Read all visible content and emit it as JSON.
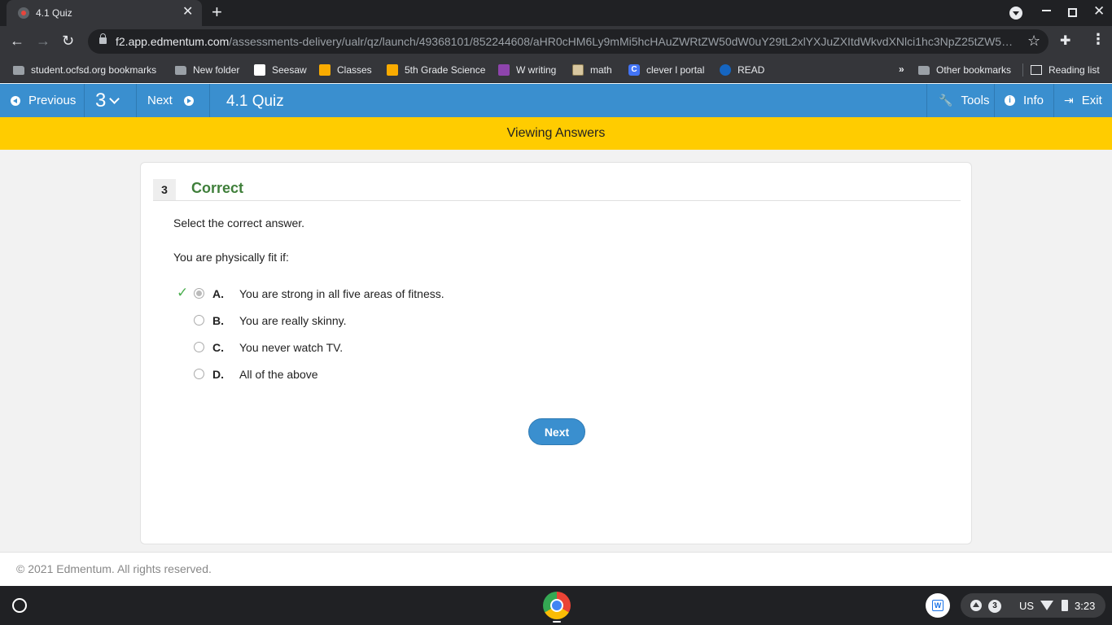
{
  "browser": {
    "tab_title": "4.1 Quiz",
    "url_host": "f2.app.edmentum.com",
    "url_path": "/assessments-delivery/ualr/qz/launch/49368101/852244608/aHR0cHM6Ly9mMi5hcHAuZWRtZW50dW0uY29tL2xlYXJuZXItdWkvdXNlci1hc3NpZ25tZW50cy1kZXRhaWwvMTQ2MjQyMDYy"
  },
  "bookmarks": [
    {
      "label": "student.ocfsd.org bookmarks",
      "icon": "folder-icon"
    },
    {
      "label": "New folder",
      "icon": "folder-icon"
    },
    {
      "label": "Seesaw",
      "icon": "seesaw-icon"
    },
    {
      "label": "Classes",
      "icon": "classroom-icon"
    },
    {
      "label": "5th Grade Science",
      "icon": "classroom-icon"
    },
    {
      "label": "W writing",
      "icon": "writing-icon"
    },
    {
      "label": "math",
      "icon": "math-icon"
    },
    {
      "label": "clever l portal",
      "icon": "clever-icon"
    },
    {
      "label": "READ",
      "icon": "read-icon"
    }
  ],
  "bookmarks_right": {
    "other": "Other bookmarks",
    "reading_list": "Reading list"
  },
  "header": {
    "previous_label": "Previous",
    "question_number": "3",
    "next_label": "Next",
    "title": "4.1 Quiz",
    "tools_label": "Tools",
    "info_label": "Info",
    "exit_label": "Exit"
  },
  "banner": {
    "text": "Viewing Answers"
  },
  "question": {
    "number": "3",
    "status": "Correct",
    "instruction": "Select the correct answer.",
    "prompt": "You are physically fit if:",
    "choices": [
      {
        "letter": "A.",
        "text": "You are strong in all five areas of fitness.",
        "selected": true,
        "correct": true
      },
      {
        "letter": "B.",
        "text": "You are really skinny.",
        "selected": false,
        "correct": false
      },
      {
        "letter": "C.",
        "text": "You never watch TV.",
        "selected": false,
        "correct": false
      },
      {
        "letter": "D.",
        "text": "All of the above",
        "selected": false,
        "correct": false
      }
    ],
    "next_button": "Next"
  },
  "footer": {
    "copyright": "© 2021 Edmentum. All rights reserved."
  },
  "shelf": {
    "notification_count": "3",
    "language": "US",
    "time": "3:23"
  },
  "colors": {
    "header_blue": "#3a8fcf",
    "banner_yellow": "#ffcc00",
    "correct_green": "#3f7f3a"
  }
}
